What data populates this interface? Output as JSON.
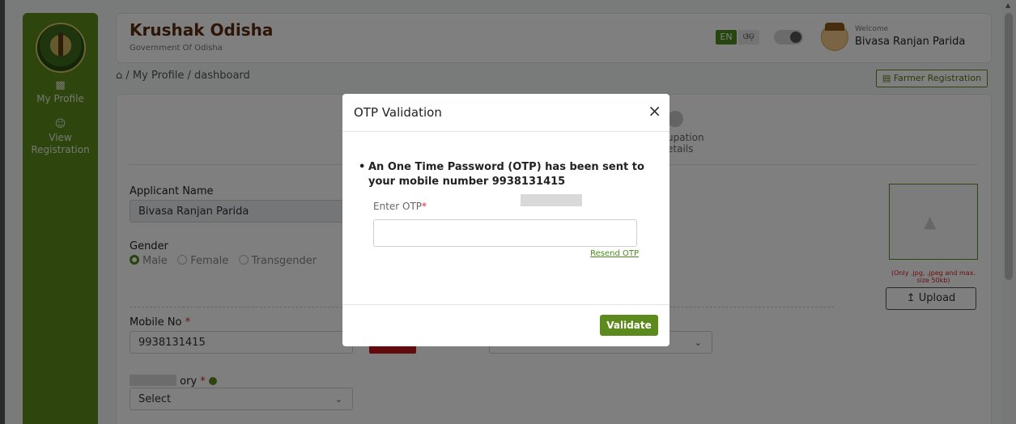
{
  "sidebar": {
    "items": [
      {
        "label": "My Profile",
        "icon": "profile-card-icon"
      },
      {
        "label": "View Registration",
        "icon": "user-icon"
      }
    ]
  },
  "header": {
    "brand": "Krushak Odisha",
    "subtitle": "Government Of Odisha",
    "lang_en": "EN",
    "lang_od": "ଓଡ଼",
    "welcome": "Welcome",
    "user_name": "Bivasa Ranjan Parida"
  },
  "breadcrumb": "/ My Profile / dashboard",
  "farmer_registration": "Farmer Registration",
  "steps": {
    "step_label": "upation\netails"
  },
  "form": {
    "applicant_name_label": "Applicant Name",
    "applicant_name_value": "Bivasa Ranjan Parida",
    "gender_label": "Gender",
    "gender_options": [
      "Male",
      "Female",
      "Transgender"
    ],
    "mobile_label": "Mobile No",
    "mobile_value": "9938131415",
    "category_label_partial": "ory",
    "select_placeholder": "Select",
    "photo_note": "(Only .jpg, .jpeg and max. size 50kb)",
    "upload_label": "Upload"
  },
  "modal": {
    "title": "OTP Validation",
    "close": "×",
    "message": "An One Time Password (OTP) has been sent to your mobile number 9938131415",
    "otp_label": "Enter OTP",
    "resend": "Resend OTP",
    "validate": "Validate"
  },
  "colors": {
    "primary_green": "#5d8a1c",
    "brand_brown": "#5a2a0e",
    "required_red": "#d23"
  }
}
